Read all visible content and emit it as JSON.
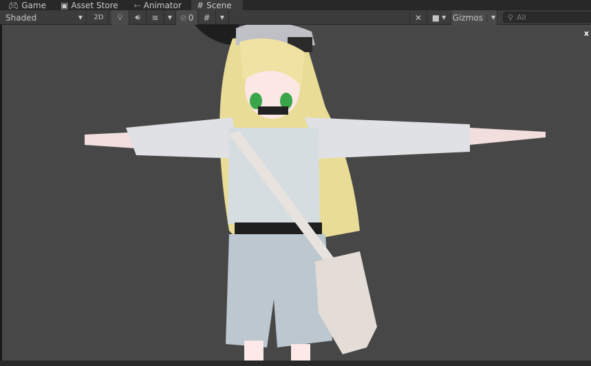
{
  "tabs": [
    {
      "label": "Game",
      "icon": "gamepad-icon"
    },
    {
      "label": "Asset Store",
      "icon": "shopping-bag-icon"
    },
    {
      "label": "Animator",
      "icon": "animator-icon"
    },
    {
      "label": "Scene",
      "icon": "grid-hash-icon",
      "active": true
    }
  ],
  "toolbar": {
    "draw_mode": "Shaded",
    "mode_2d": "2D",
    "hidden_count": "0",
    "gizmos": "Gizmos",
    "search_placeholder": "All"
  },
  "viewport": {
    "close_label": "x",
    "background": "#474747"
  }
}
